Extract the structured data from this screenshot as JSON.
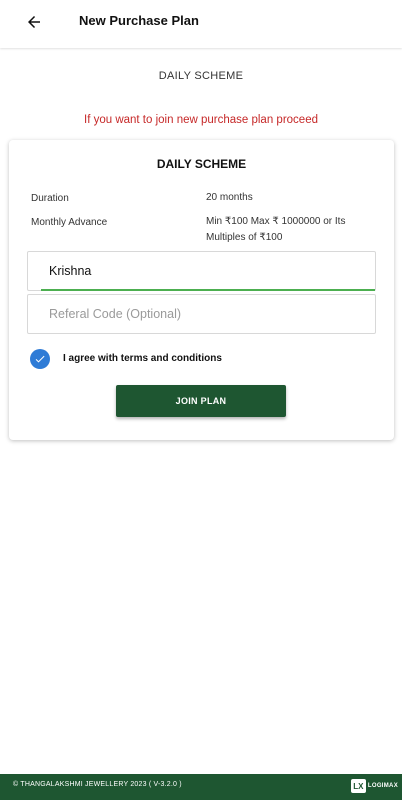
{
  "header": {
    "back_icon": "arrow-left-icon",
    "title": "New Purchase Plan"
  },
  "scheme_heading": "DAILY SCHEME",
  "notice": "If you want to join new purchase plan proceed",
  "card": {
    "title": "DAILY SCHEME",
    "rows": [
      {
        "label": "Duration",
        "value": "20 months"
      },
      {
        "label": "Monthly Advance",
        "value": "Min ₹100 Max ₹ 1000000 or Its Multiples of ₹100"
      }
    ],
    "name_field": {
      "value": "Krishna",
      "placeholder": ""
    },
    "referral_field": {
      "value": "",
      "placeholder": "Referal Code (Optional)"
    },
    "terms": {
      "label": "I agree with terms and conditions",
      "checked": true,
      "icon": "check-icon"
    },
    "join_label": "JOIN PLAN"
  },
  "footer": {
    "text": "© THANGALAKSHMI JEWELLERY 2023 ( V-3.2.0 )",
    "logo_mark": "LX",
    "logo_text": "LOGIMAX"
  },
  "colors": {
    "primary_green": "#1e5631",
    "accent_green": "#4caf50",
    "notice_red": "#c62828",
    "check_blue": "#2e7bd6"
  }
}
